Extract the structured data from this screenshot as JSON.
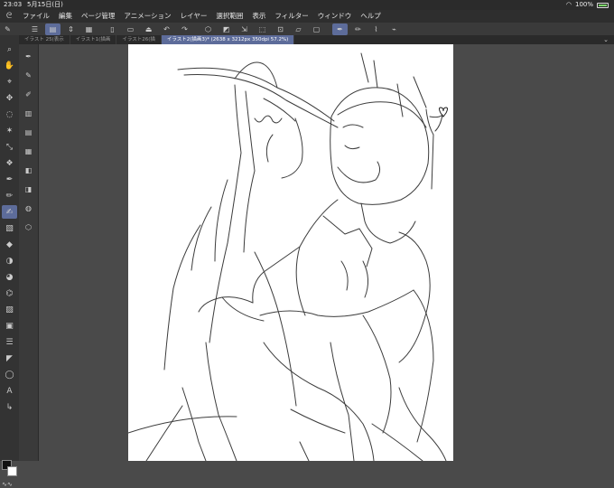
{
  "statusbar": {
    "time": "23:03",
    "date": "5月15日(日)",
    "battery": "100%"
  },
  "menubar": {
    "items": [
      "ファイル",
      "編集",
      "ページ管理",
      "アニメーション",
      "レイヤー",
      "選択範囲",
      "表示",
      "フィルター",
      "ウィンドウ",
      "ヘルプ"
    ]
  },
  "tabs": [
    {
      "label": "イラスト 25(表示"
    },
    {
      "label": "イラスト1(描画"
    },
    {
      "label": "イラスト26(描"
    },
    {
      "label": "イラスト2(描画3)* (2638 x 3212px 350dpi 57.2%)"
    }
  ],
  "toolbar_icons": [
    "menu-icon",
    "layer-icon",
    "stepper-icon",
    "grid-icon",
    "new-icon",
    "open-icon",
    "save-icon",
    "undo-icon",
    "redo-icon",
    "cut-icon",
    "fill-icon",
    "transform-icon",
    "clear-icon",
    "crop-icon",
    "smooth-icon",
    "pen-icon",
    "pencil-icon",
    "brush-icon",
    "ruler-icon"
  ],
  "colors": {
    "accent": "#5d6c9a",
    "bg": "#4a4a4a",
    "panel": "#333333"
  }
}
